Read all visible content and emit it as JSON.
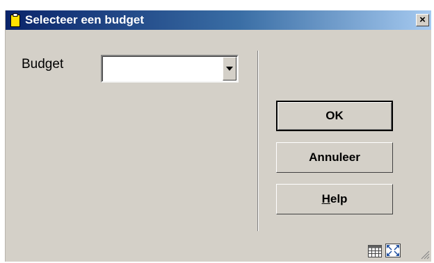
{
  "window": {
    "title": "Selecteer een budget",
    "close_label": "×"
  },
  "form": {
    "budget_label": "Budget",
    "budget_value": ""
  },
  "buttons": {
    "ok_label": "OK",
    "cancel_label": "Annuleer",
    "help_first_letter": "H",
    "help_rest": "elp"
  },
  "icons": {
    "title_icon": "clipboard-icon",
    "close_icon": "close-icon",
    "dropdown_icon": "chevron-down-icon",
    "status_table_icon": "table-icon",
    "status_expand_icon": "expand-icon",
    "size_grip_icon": "resize-grip-icon"
  },
  "colors": {
    "titlebar_start": "#0a246a",
    "titlebar_end": "#a6caf0",
    "face": "#d4d0c8"
  }
}
